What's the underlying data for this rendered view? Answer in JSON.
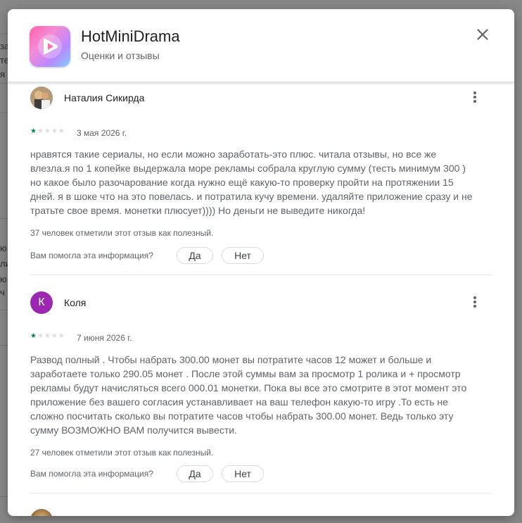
{
  "background": {
    "fragments": [
      "за",
      "те",
      "я",
      "ю",
      "ли",
      "ю",
      "ч"
    ]
  },
  "header": {
    "app_name": "HotMiniDrama",
    "subtitle": "Оценки и отзывы",
    "icons": {
      "app": "play-icon",
      "close": "close-icon"
    }
  },
  "reviews": [
    {
      "author": "Наталия Сикирда",
      "avatar_type": "photo",
      "rating": 1,
      "stars": {
        "on": "★",
        "off": "★★★★"
      },
      "date": "3 мая 2026 г.",
      "text": "нравятся такие сериалы, но если можно заработать-это плюс. читала отзывы, но все же влезла.я по 1 копейке выдержала море рекламы собрала круглую сумму (тесть минимум 300 ) но какое было разочарование когда нужно ещё какую-то проверку пройти на протяжении 15 дней. я в шоке что на это повелась. и потратила кучу времени. удаляйте приложение сразу и не тратьте свое время. монетки плюсует)))) Но деньги не выведите никогда!",
      "helpful_count": "37 человек отметили этот отзыв как полезный.",
      "helpful_question": "Вам помогла эта информация?",
      "yes_label": "Да",
      "no_label": "Нет"
    },
    {
      "author": "Коля",
      "avatar_letter": "К",
      "avatar_color": "#9c27b0",
      "rating": 1,
      "stars": {
        "on": "★",
        "off": "★★★★"
      },
      "date": "7 июня 2026 г.",
      "text": "Развод полный . Чтобы набрать 300.00 монет вы потратите часов 12 может и больше и заработаете только 290.05 монет . После этой суммы вам за просмотр 1 ролика и + просмотр рекламы будут начисляться всего 000.01 монетки. Пока вы все это смотрите в этот момент это приложение без вашего согласия устанавливает на ваш телефон какую-то игру .То есть не сложно посчитать сколько вы потратите часов чтобы набрать 300.00 монет. Ведь только эту сумму ВОЗМОЖНО ВАМ получится вывести.",
      "helpful_count": "27 человек отметили этот отзыв как полезный.",
      "helpful_question": "Вам помогла эта информация?",
      "yes_label": "Да",
      "no_label": "Нет"
    }
  ],
  "colors": {
    "star_on": "#01875f",
    "star_off": "#dadce0",
    "avatar_letter_bg": "#9c27b0"
  }
}
